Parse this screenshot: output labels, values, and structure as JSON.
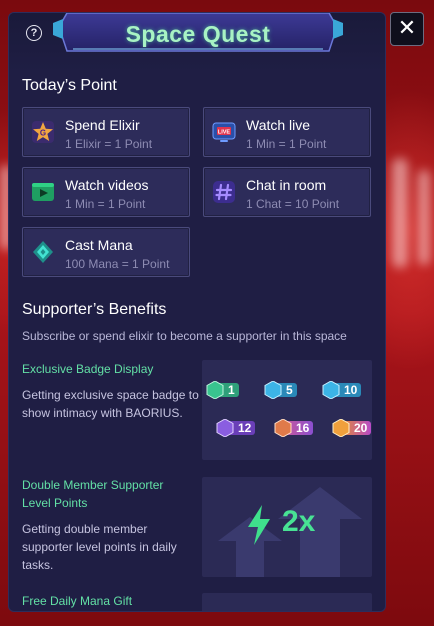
{
  "header": {
    "title": "Space Quest"
  },
  "todays_point": {
    "heading": "Today’s Point",
    "items": [
      {
        "title": "Spend Elixir",
        "subtitle": "1 Elixir = 1 Point"
      },
      {
        "title": "Watch live",
        "subtitle": "1 Min = 1 Point"
      },
      {
        "title": "Watch videos",
        "subtitle": "1 Min = 1 Point"
      },
      {
        "title": "Chat in room",
        "subtitle": "1 Chat = 10 Point"
      },
      {
        "title": "Cast Mana",
        "subtitle": "100 Mana = 1 Point"
      }
    ]
  },
  "benefits": {
    "heading": "Supporter’s Benefits",
    "subtitle": "Subscribe or spend elixir to become a supporter in this space",
    "items": [
      {
        "title": "Exclusive Badge Display",
        "description": "Getting exclusive space badge to show intimacy with BAORIUS."
      },
      {
        "title": "Double Member Supporter Level Points",
        "description": "Getting double member supporter level points in daily tasks."
      },
      {
        "title": "Free Daily Mana Gift",
        "description": ""
      }
    ],
    "badges": [
      "1",
      "5",
      "10",
      "12",
      "16",
      "20"
    ],
    "multiplier": "2x"
  },
  "colors": {
    "accent_green": "#63e0a6",
    "title_green": "#a8f3c4",
    "panel_bg": "#1f1e44",
    "card_bg": "#2d2c5a"
  }
}
